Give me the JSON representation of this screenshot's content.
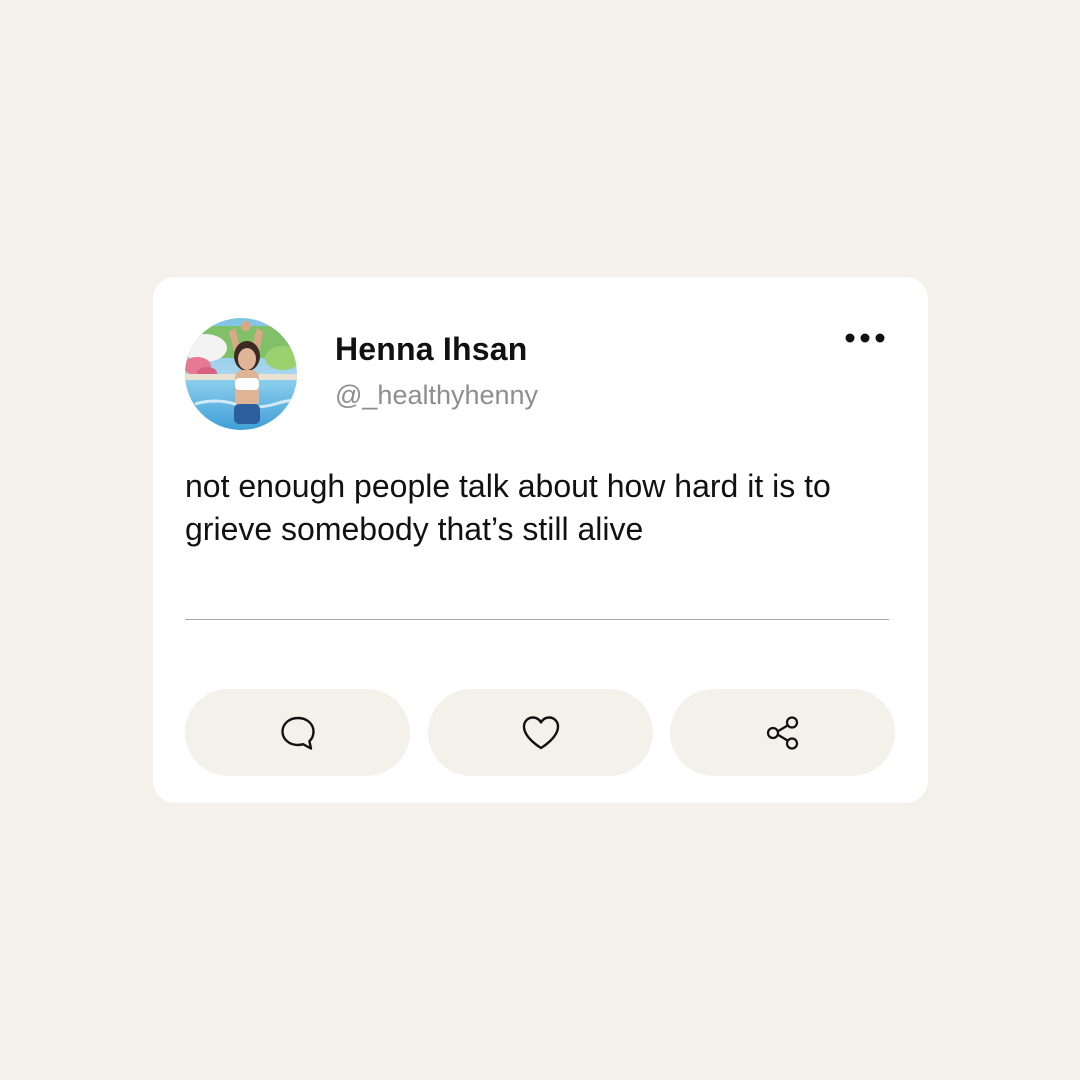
{
  "post": {
    "author": {
      "display_name": "Henna Ihsan",
      "handle": "@_healthyhenny",
      "avatar": "profile-photo"
    },
    "text": "not enough people talk about how hard it is to grieve somebody that’s still alive",
    "menu_icon": "more-horizontal-icon",
    "actions": [
      {
        "name": "comment",
        "icon": "comment-bubble-icon"
      },
      {
        "name": "like",
        "icon": "heart-icon"
      },
      {
        "name": "share",
        "icon": "share-nodes-icon"
      }
    ]
  },
  "colors": {
    "background": "#f4f0ea",
    "card": "#ffffff",
    "button": "#f4f0ea",
    "text_primary": "#111111",
    "text_secondary": "#8e8e8e",
    "divider": "#a9a9a9"
  }
}
